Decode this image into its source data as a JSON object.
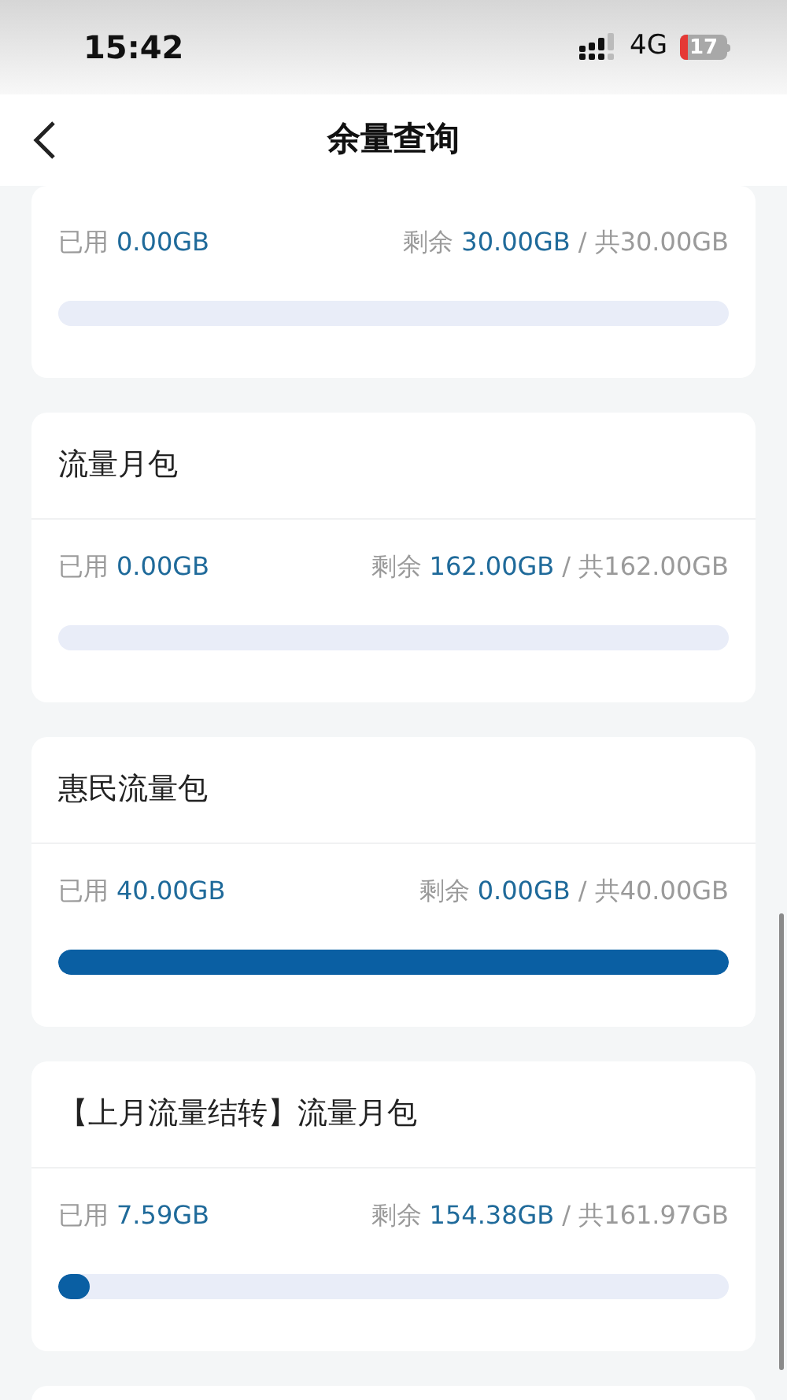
{
  "status_bar": {
    "time": "15:42",
    "network": "4G",
    "battery": "17"
  },
  "nav": {
    "title": "余量查询"
  },
  "packages": [
    {
      "used_label": "已用",
      "used": "0.00GB",
      "remaining_label": "剩余",
      "remaining": "30.00GB",
      "total": "/ 共30.00GB",
      "level": 0
    },
    {
      "title": "流量月包",
      "used_label": "已用",
      "used": "0.00GB",
      "remaining_label": "剩余",
      "remaining": "162.00GB",
      "total": "/ 共162.00GB",
      "level": 0
    },
    {
      "title": "惠民流量包",
      "used_label": "已用",
      "used": "40.00GB",
      "remaining_label": "剩余",
      "remaining": "0.00GB",
      "total": "/ 共40.00GB",
      "level": 1
    },
    {
      "title": "【上月流量结转】流量月包",
      "used_label": "已用",
      "used": "7.59GB",
      "remaining_label": "剩余",
      "remaining": "154.38GB",
      "total": "/ 共161.97GB",
      "level": 0.047
    }
  ]
}
